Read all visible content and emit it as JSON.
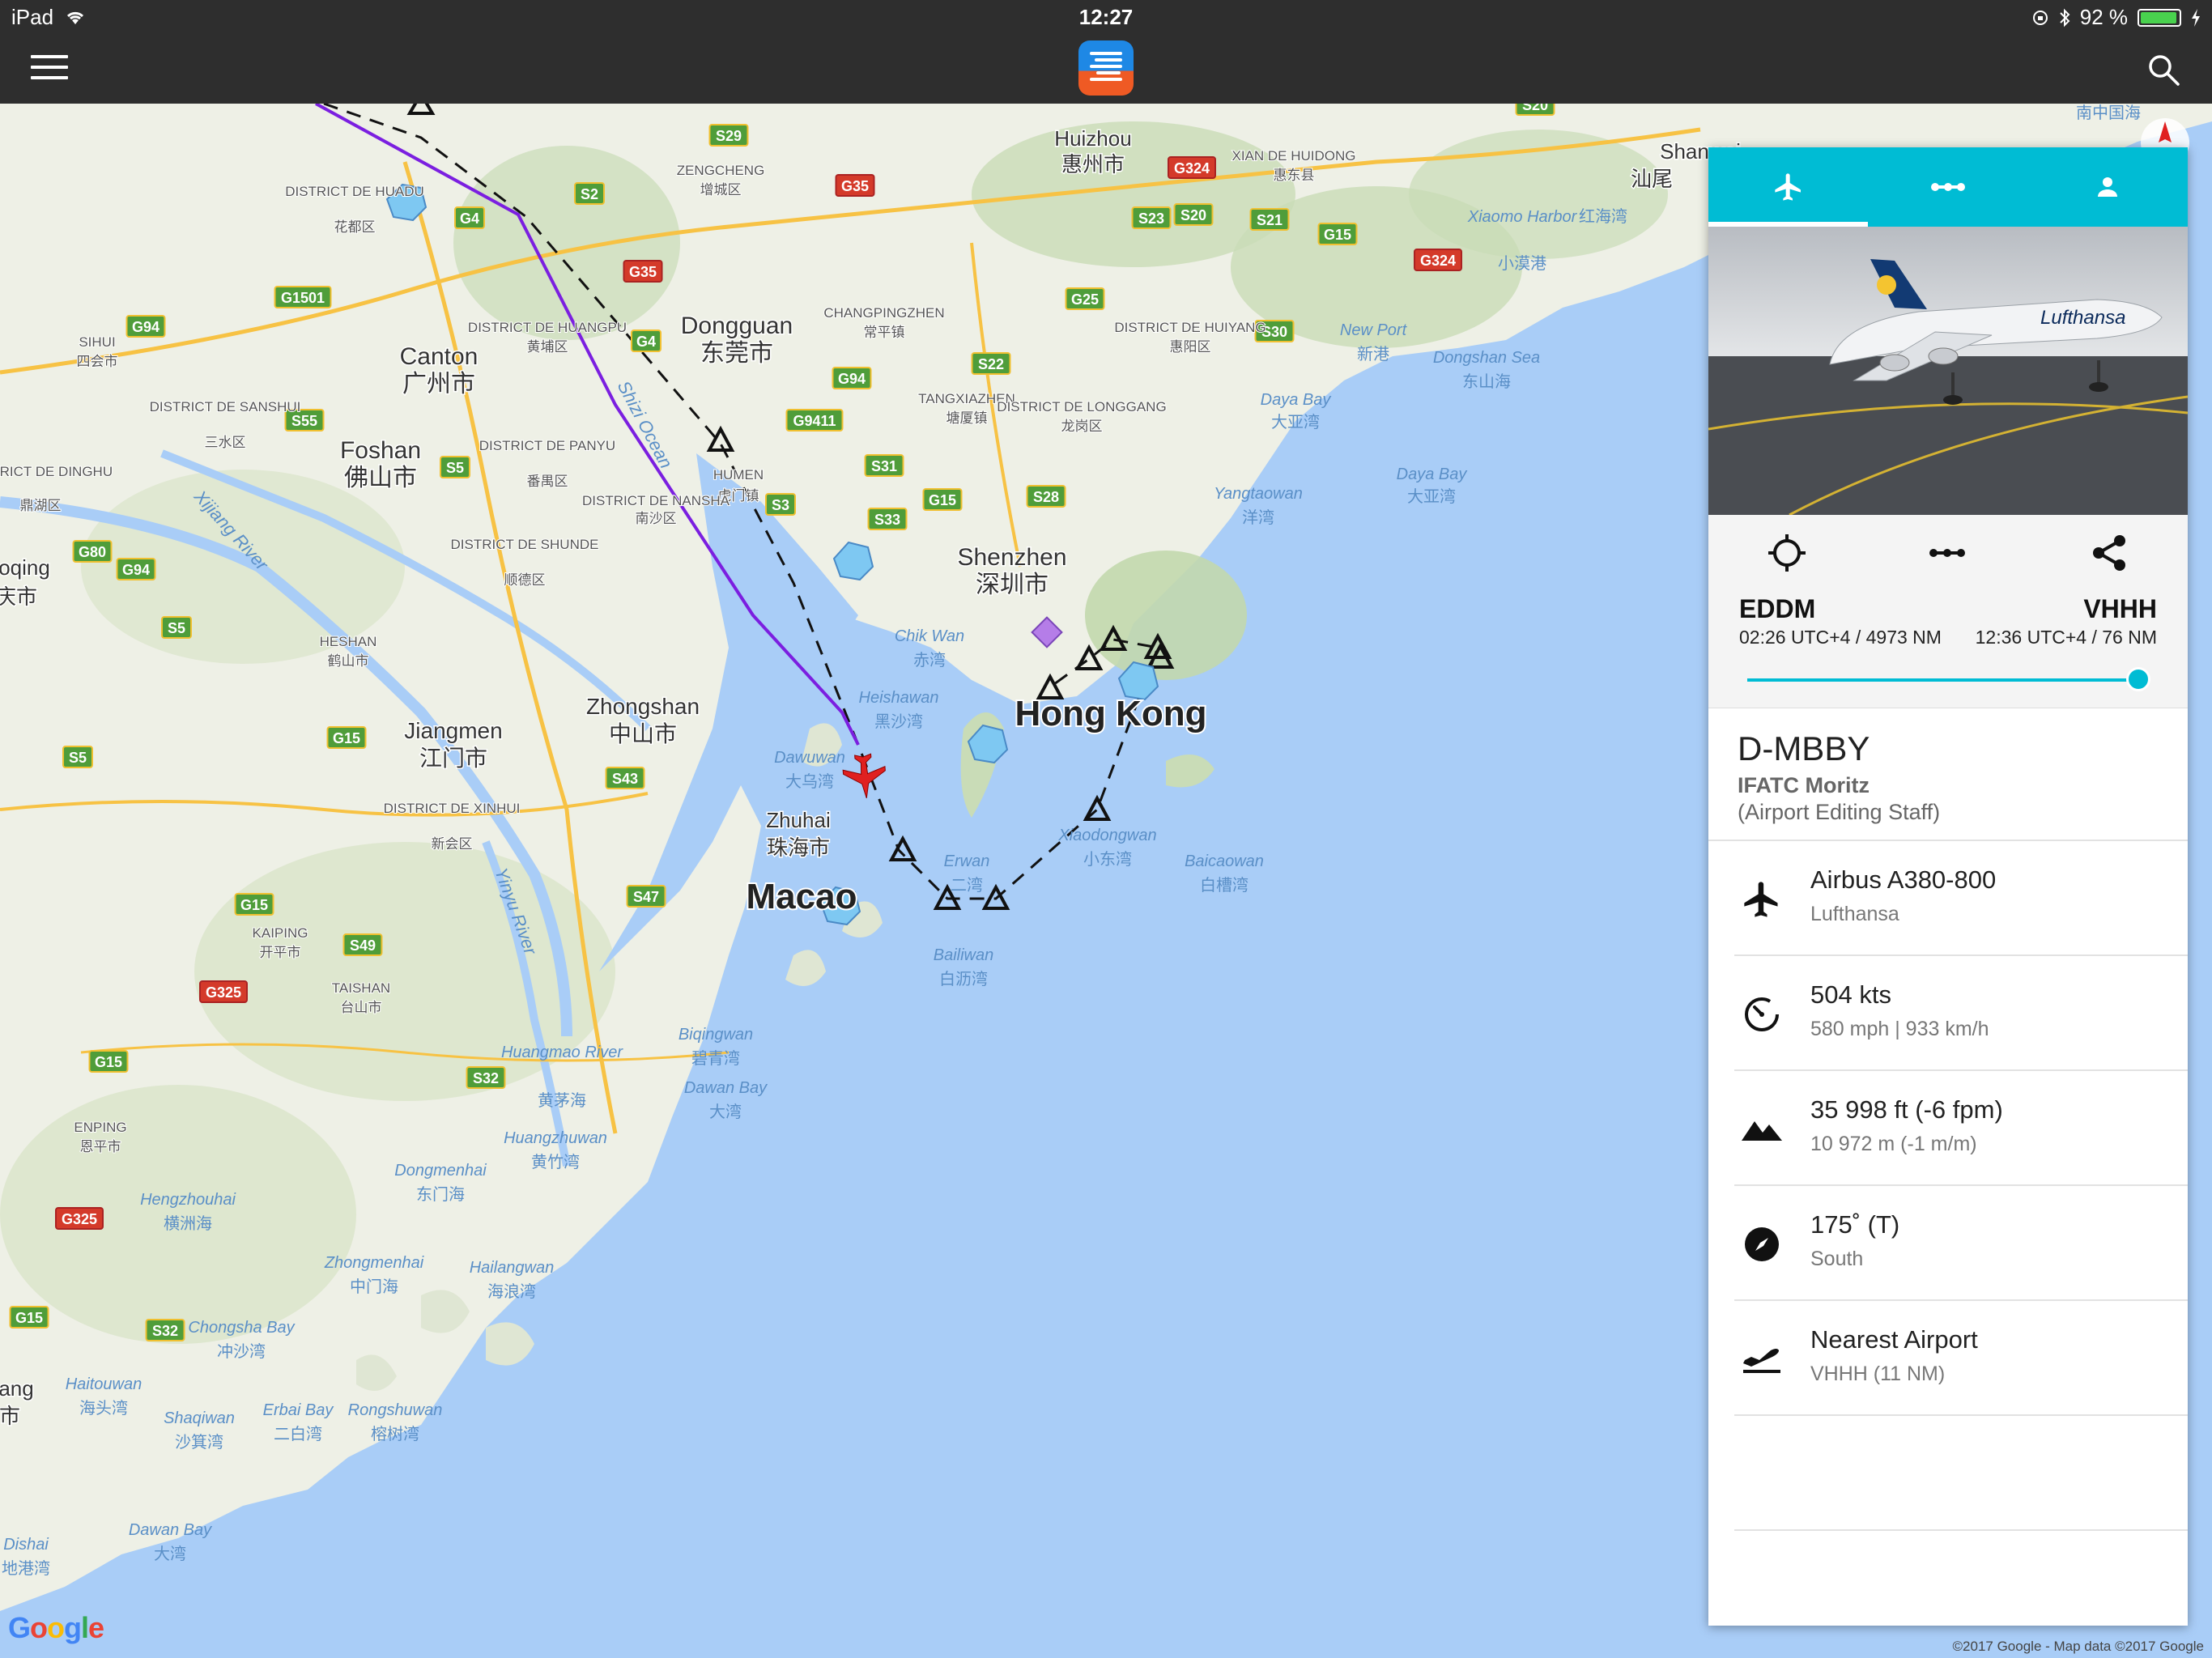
{
  "status_bar": {
    "device": "iPad",
    "time": "12:27",
    "battery": "92 %",
    "icons": [
      "wifi-icon",
      "orientation-lock-icon",
      "bluetooth-icon",
      "battery-icon",
      "charging-icon"
    ]
  },
  "toolbar": {
    "menu_icon": "hamburger-icon",
    "logo_icon": "app-logo-icon",
    "search_icon": "search-icon"
  },
  "map": {
    "labels": {
      "huizhou": "Huizhou",
      "huizhou_zh": "惠州市",
      "dongguan": "Dongguan",
      "dongguan_zh": "东莞市",
      "canton": "Canton",
      "canton_zh": "广州市",
      "foshan": "Foshan",
      "foshan_zh": "佛山市",
      "shenzhen": "Shenzhen",
      "shenzhen_zh": "深圳市",
      "hongkong": "Hong Kong",
      "zhongshan": "Zhongshan",
      "zhongshan_zh": "中山市",
      "jiangmen": "Jiangmen",
      "jiangmen_zh": "江门市",
      "zhuhai": "Zhuhai",
      "zhuhai_zh": "珠海市",
      "macao": "Macao",
      "shanwei": "Shanwei",
      "shanwei_zh": "汕尾",
      "south_china_sea_zh": "南中国海",
      "daya_bay": "Daya Bay",
      "daya_bay_zh": "大亚湾",
      "daya_bay2": "Daya Bay",
      "daya_bay2_zh": "大亚湾",
      "dongshan_sea": "Dongshan Sea",
      "dongshan_sea_zh": "东山海",
      "yangtaowan": "Yangtaowan",
      "yangtaowan_zh": "洋湾",
      "new_port": "New Port",
      "new_port_zh": "新港",
      "xiaomo_harbor": "Xiaomo Harbor",
      "xiaomo_harbor_zh": "小漠港",
      "honghai_bay_zh": "红海湾",
      "heishawan": "Heishawan",
      "heishawan_zh": "黑沙湾",
      "chik_wan": "Chik Wan",
      "chik_wan_zh": "赤湾",
      "dawuwan": "Dawuwan",
      "dawuwan_zh": "大乌湾",
      "xiaodongwan": "Xiaodongwan",
      "xiaodongwan_zh": "小东湾",
      "baicaowan": "Baicaowan",
      "baicaowan_zh": "白槽湾",
      "erwan": "Erwan",
      "erwan_zh": "二湾",
      "bailiwan": "Bailiwan",
      "bailiwan_zh": "白沥湾",
      "biqinwan": "Biqingwan",
      "biqinwan_zh": "碧青湾",
      "dawan_bay": "Dawan Bay",
      "dawan_bay_zh": "大湾",
      "huangmao_river": "Huangmao River",
      "huangmao_river_zh": "黄茅海",
      "huangzhuwan": "Huangzhuwan",
      "huangzhuwan_zh": "黄竹湾",
      "dongmenhai": "Dongmenhai",
      "dongmenhai_zh": "东门海",
      "hengzhouhai": "Hengzhouhai",
      "hengzhouhai_zh": "横洲海",
      "zhongmenhai": "Zhongmenhai",
      "zhongmenhai_zh": "中门海",
      "hailangwan": "Hailangwan",
      "hailangwan_zh": "海浪湾",
      "chongsha_bay": "Chongsha Bay",
      "chongsha_bay_zh": "冲沙湾",
      "haitouwan": "Haitouwan",
      "haitouwan_zh": "海头湾",
      "shaqiwan": "Shaqiwan",
      "shaqiwan_zh": "沙箕湾",
      "erbai_bay": "Erbai Bay",
      "erbai_bay_zh": "二白湾",
      "rongshuwan": "Rongshuwan",
      "rongshuwan_zh": "榕树湾",
      "dawan_bay2": "Dawan Bay",
      "dawan_bay2_zh": "大湾",
      "dishai": "Dishai",
      "dishai_zh": "地港湾",
      "shizi_ocean": "Shizi Ocean",
      "xijiang_river": "Xijiang River",
      "yinyu_river": "Yinyu River",
      "humen": "HUMEN",
      "humen_zh": "虎门镇",
      "changpingzhen": "CHANGPINGZHEN",
      "changpingzhen_zh": "常平镇",
      "tangxiazhen": "TANGXIAZHEN",
      "tangxiazhen_zh": "塘厦镇",
      "zengcheng": "ZENGCHENG",
      "zengcheng_zh": "增城区",
      "xian_de_huidong": "XIAN DE HUIDONG",
      "xian_de_huidong_zh": "惠东县",
      "district_de_huiyang": "DISTRICT DE HUIYANG",
      "district_de_huiyang_zh": "惠阳区",
      "district_de_longgang": "DISTRICT DE LONGGANG",
      "district_de_longgang_zh": "龙岗区",
      "district_de_huangpu": "DISTRICT DE HUANGPU",
      "district_de_huangpu_zh": "黄埔区",
      "district_de_huadu": "DISTRICT DE HUADU",
      "district_de_huadu_zh": "花都区",
      "district_de_panyu": "DISTRICT DE PANYU",
      "district_de_panyu_zh": "番禺区",
      "district_de_nansha": "DISTRICT DE NANSHA",
      "district_de_nansha_zh": "南沙区",
      "district_de_shunde": "DISTRICT DE SHUNDE",
      "district_de_shunde_zh": "顺德区",
      "district_de_sanshui": "DISTRICT DE SANSHUI",
      "district_de_sanshui_zh": "三水区",
      "district_de_dinghu": "DISTRICT DE DINGHU",
      "district_de_dinghu_zh": "鼎湖区",
      "district_de_xinhui": "DISTRICT DE XINHUI",
      "district_de_xinhui_zh": "新会区",
      "sihui": "SIHUI",
      "sihui_zh": "四会市",
      "heshan": "HESHAN",
      "heshan_zh": "鹤山市",
      "kaiping": "KAIPING",
      "kaiping_zh": "开平市",
      "taishan": "TAISHAN",
      "taishan_zh": "台山市",
      "enping": "ENPING",
      "enping_zh": "恩平市",
      "zhaoqing_partial": "oqing",
      "zhaoqing_partial_zh": "庆市",
      "yangjiang_partial": "ang",
      "yangjiang_partial_zh": "市"
    },
    "shields": [
      "S29",
      "G35",
      "S2",
      "G4",
      "G35",
      "G1501",
      "G94",
      "S55",
      "S5",
      "G4",
      "G9411",
      "G94",
      "S22",
      "G25",
      "S23",
      "S20",
      "S21",
      "G15",
      "G324",
      "G324",
      "S30",
      "S20",
      "S31",
      "S33",
      "G15",
      "S28",
      "S3",
      "G80",
      "G94",
      "S5",
      "G15",
      "S5",
      "S43",
      "G15",
      "S49",
      "G325",
      "S47",
      "G15",
      "S32",
      "G325",
      "G15",
      "S32"
    ]
  },
  "panel": {
    "tabs": [
      {
        "icon": "airplane-icon"
      },
      {
        "icon": "route-icon"
      },
      {
        "icon": "person-icon"
      }
    ],
    "photo_label": "Lufthansa",
    "route": {
      "origin": "EDDM",
      "origin_sub": "02:26 UTC+4 / 4973 NM",
      "destination": "VHHH",
      "destination_sub": "12:36 UTC+4 / 76 NM",
      "progress": 0.985
    },
    "callsign": "D-MBBY",
    "pilot": "IFATC Moritz",
    "role": "(Airport Editing Staff)",
    "rows": [
      {
        "icon": "airplane-icon",
        "main": "Airbus A380-800",
        "sub": "Lufthansa"
      },
      {
        "icon": "speedometer-icon",
        "main": "504 kts",
        "sub": "580 mph | 933 km/h"
      },
      {
        "icon": "mountain-icon",
        "main": "35 998 ft (-6 fpm)",
        "sub": "10 972 m (-1 m/m)"
      },
      {
        "icon": "compass-icon",
        "main": "175˚ (T)",
        "sub": "South"
      },
      {
        "icon": "takeoff-icon",
        "main": "Nearest Airport",
        "sub": "VHHH (11 NM)"
      }
    ]
  },
  "footer": {
    "google": "Google",
    "copyright": "©2017 Google - Map data ©2017 Google"
  },
  "colors": {
    "toolbar": "#2e2e2e",
    "accent": "#00bcd4",
    "sea": "#a9cdf7",
    "land": "#eef0e6",
    "track": "#7b1fe0",
    "plane": "#e02020"
  }
}
